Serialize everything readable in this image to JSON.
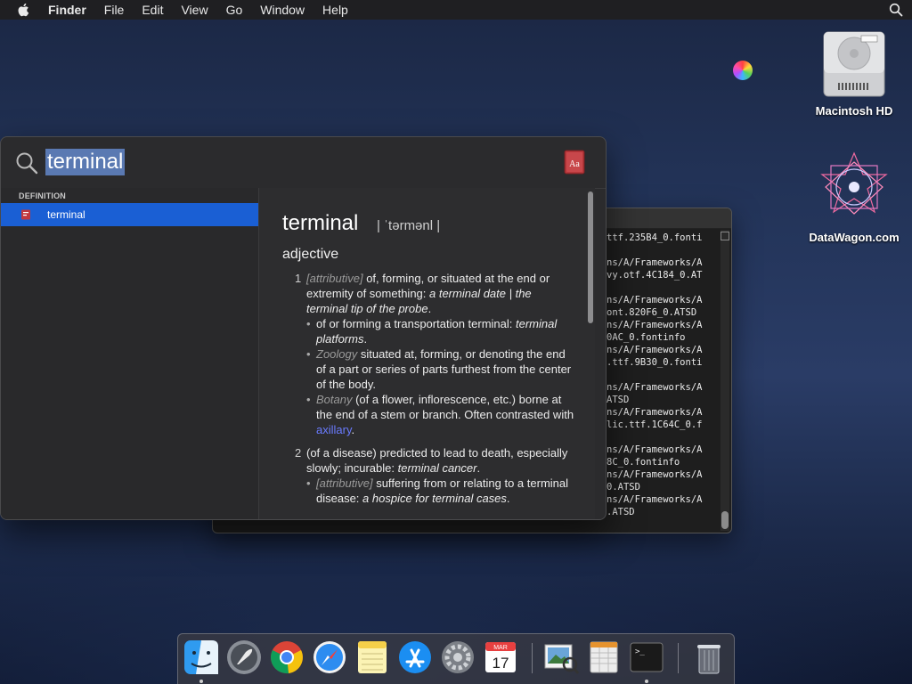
{
  "menubar": {
    "items": [
      "Finder",
      "File",
      "Edit",
      "View",
      "Go",
      "Window",
      "Help"
    ],
    "icons": [
      "apple-icon",
      "spotlight-search-icon"
    ]
  },
  "desktop": {
    "icons": [
      {
        "label": "Macintosh HD",
        "icon": "hard-drive-icon"
      },
      {
        "label": "DataWagon.com",
        "icon": "datawagon-logo-icon"
      }
    ]
  },
  "terminal": {
    "lines": [
      "ttf.235B4_0.fonti",
      "",
      "ns/A/Frameworks/A",
      "vy.otf.4C184_0.AT",
      "",
      "ns/A/Frameworks/A",
      "ont.820F6_0.ATSD",
      "ns/A/Frameworks/A",
      "0AC_0.fontinfo",
      "ns/A/Frameworks/A",
      ".ttf.9B30_0.fonti",
      "",
      "ns/A/Frameworks/A",
      "ATSD",
      "ns/A/Frameworks/A",
      "lic.ttf.1C64C_0.f",
      "",
      "ns/A/Frameworks/A",
      "8C_0.fontinfo",
      "ns/A/Frameworks/A",
      "0.ATSD",
      "ns/A/Frameworks/A",
      ".ATSD"
    ]
  },
  "spotlight": {
    "query": "terminal",
    "section_label": "DEFINITION",
    "result_label": "terminal",
    "entry": {
      "headword": "terminal",
      "pronunciation": "| ˈtərmənl |",
      "part_of_speech": "adjective",
      "sense1": {
        "num": "1",
        "tag": "[attributive]",
        "text": " of, forming, or situated at the end or extremity of something: ",
        "example": "a terminal date | the terminal tip of the probe",
        "end": "."
      },
      "sub1": {
        "text": "of or forming a transportation terminal: ",
        "example": "terminal platforms",
        "end": "."
      },
      "sub2": {
        "tag": "Zoology",
        "text": " situated at, forming, or denoting the end of a part or series of parts furthest from the center of the body."
      },
      "sub3": {
        "tag": "Botany",
        "text": " (of a flower, inflorescence, etc.) borne at the end of a stem or branch. Often contrasted with ",
        "link": "axillary",
        "end": "."
      },
      "sense2": {
        "num": "2",
        "text": "(of a disease) predicted to lead to death, especially slowly; incurable: ",
        "example": "terminal cancer",
        "end": "."
      },
      "sub4": {
        "tag": "[attributive]",
        "text": " suffering from or relating to a terminal disease: ",
        "example": "a hospice for terminal cases",
        "end": "."
      }
    }
  },
  "dock": {
    "items": [
      "finder-icon",
      "launchpad-icon",
      "chrome-icon",
      "safari-icon",
      "notes-icon",
      "app-store-icon",
      "system-preferences-icon",
      "calendar-icon",
      "preview-icon",
      "numbers-icon",
      "terminal-icon",
      "trash-icon"
    ],
    "calendar": {
      "month": "MAR",
      "day": "17"
    }
  },
  "colors": {
    "selection": "#1a5fd4",
    "highlight": "#5a79b2",
    "link": "#6a7bff"
  }
}
